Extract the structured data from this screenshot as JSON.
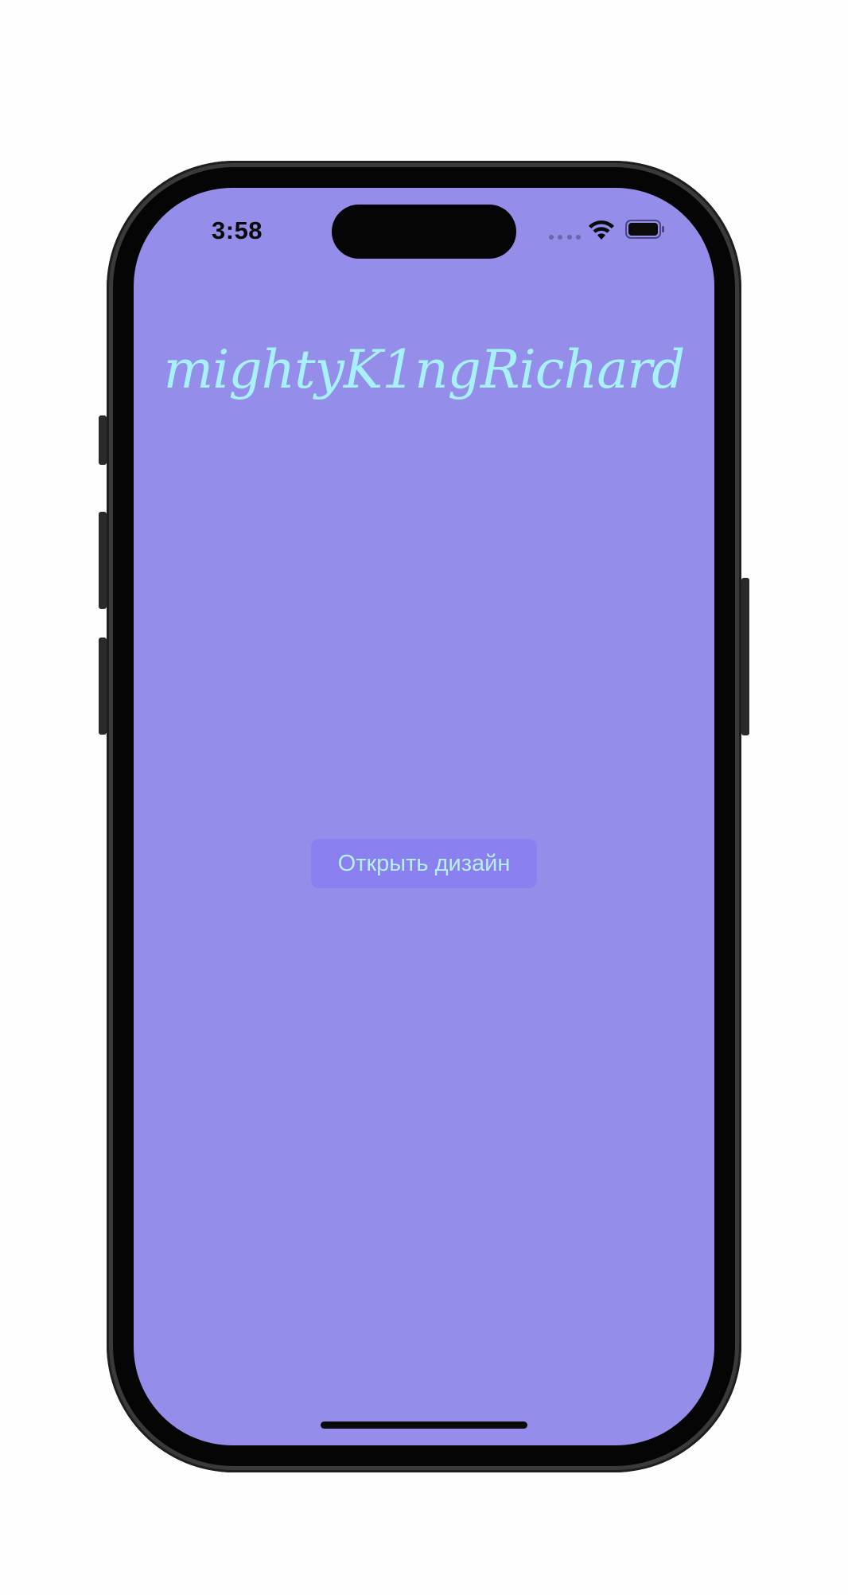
{
  "status_bar": {
    "time": "3:58",
    "icons": [
      "signal-dots-icon",
      "wifi-icon",
      "battery-icon"
    ]
  },
  "main": {
    "title": "mightyK1ngRichard",
    "open_design_button_label": "Открыть дизайн"
  },
  "colors": {
    "screen_background": "#948dea",
    "title_color": "#a7f2f8",
    "button_background": "#8a80f0",
    "button_text": "#b6f0fb",
    "frame": "#050505"
  }
}
